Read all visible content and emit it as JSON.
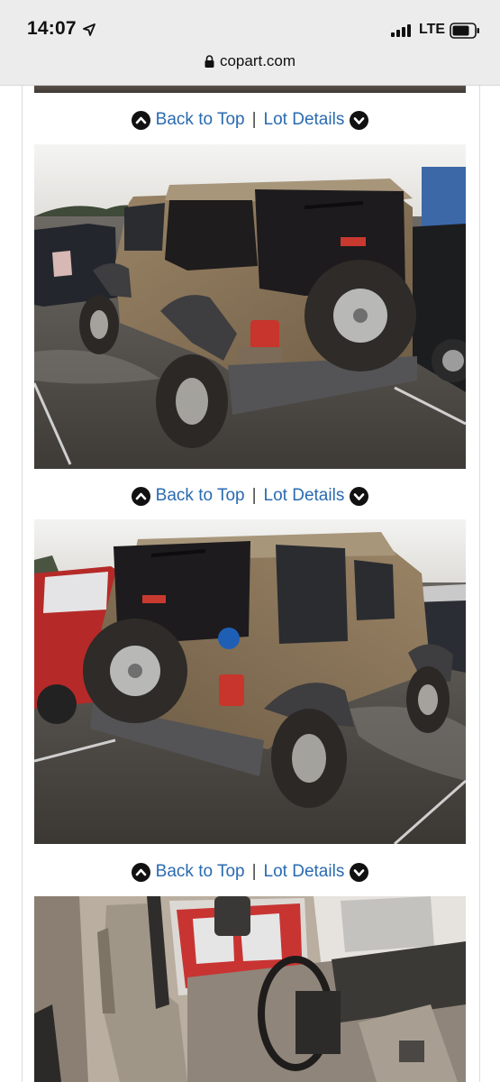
{
  "status_bar": {
    "time": "14:07",
    "network": "LTE"
  },
  "browser": {
    "url": "copart.com"
  },
  "navigation": {
    "back_to_top": "Back to Top",
    "separator": "|",
    "lot_details": "Lot Details"
  },
  "icons": {
    "location": "location-arrow-icon",
    "signal": "cellular-signal-icon",
    "battery": "battery-icon",
    "lock": "lock-icon",
    "up": "chevron-up-circle-icon",
    "down": "chevron-down-circle-icon"
  },
  "colors": {
    "link": "#2a6ab0",
    "vehicle_body": "#8a7356",
    "chrome_bg": "#ececec"
  }
}
